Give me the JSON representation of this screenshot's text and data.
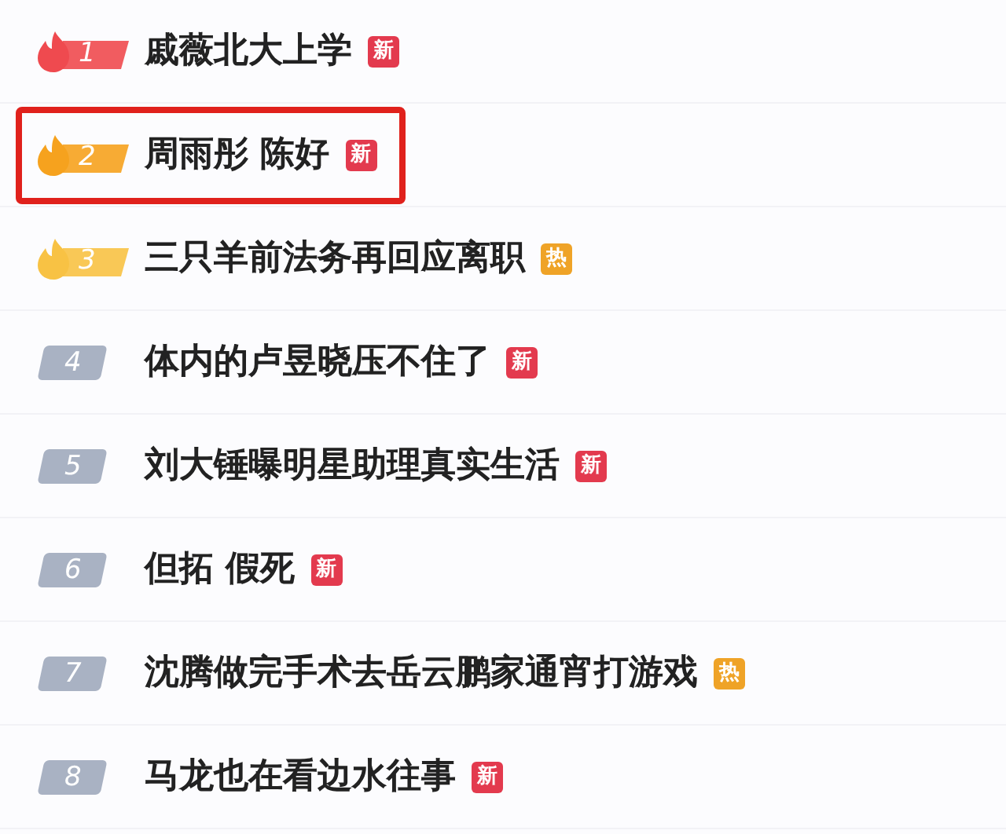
{
  "hot_list": [
    {
      "rank": "1",
      "kind": "flame",
      "color": "#ef4a4f",
      "title": "戚薇北大上学",
      "highlighted": false,
      "tag": {
        "kind": "new",
        "text": "新"
      }
    },
    {
      "rank": "2",
      "kind": "flame",
      "color": "#f6a21e",
      "title": "周雨彤 陈好",
      "highlighted": true,
      "tag": {
        "kind": "new",
        "text": "新"
      }
    },
    {
      "rank": "3",
      "kind": "flame",
      "color": "#f8c244",
      "title": "三只羊前法务再回应离职",
      "highlighted": false,
      "tag": {
        "kind": "hot",
        "text": "热"
      }
    },
    {
      "rank": "4",
      "kind": "plain",
      "color": "#a9b2c3",
      "title": "体内的卢昱晓压不住了",
      "highlighted": false,
      "tag": {
        "kind": "new",
        "text": "新"
      }
    },
    {
      "rank": "5",
      "kind": "plain",
      "color": "#a9b2c3",
      "title": "刘大锤曝明星助理真实生活",
      "highlighted": false,
      "tag": {
        "kind": "new",
        "text": "新"
      }
    },
    {
      "rank": "6",
      "kind": "plain",
      "color": "#a9b2c3",
      "title": "但拓 假死",
      "highlighted": false,
      "tag": {
        "kind": "new",
        "text": "新"
      }
    },
    {
      "rank": "7",
      "kind": "plain",
      "color": "#a9b2c3",
      "title": "沈腾做完手术去岳云鹏家通宵打游戏",
      "highlighted": false,
      "tag": {
        "kind": "hot",
        "text": "热"
      }
    },
    {
      "rank": "8",
      "kind": "plain",
      "color": "#a9b2c3",
      "title": "马龙也在看边水往事",
      "highlighted": false,
      "tag": {
        "kind": "new",
        "text": "新"
      }
    }
  ]
}
